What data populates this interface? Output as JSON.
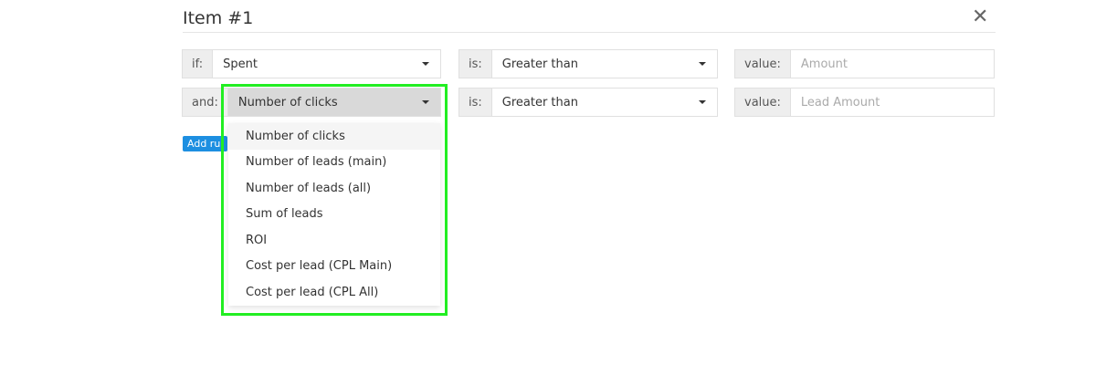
{
  "modal": {
    "title": "Item #1",
    "close_icon": "close-icon"
  },
  "rule1": {
    "prefix": "if:",
    "field": "Spent",
    "op_label": "is:",
    "operator": "Greater than",
    "value_label": "value:",
    "value_placeholder": "Amount"
  },
  "rule2": {
    "prefix": "and:",
    "field": "Number of clicks",
    "op_label": "is:",
    "operator": "Greater than",
    "value_label": "value:",
    "value_placeholder": "Lead Amount"
  },
  "add_rule_label": "Add rul",
  "dropdown_options": [
    "Number of clicks",
    "Number of leads (main)",
    "Number of leads (all)",
    "Sum of leads",
    "ROI",
    "Cost per lead (CPL Main)",
    "Cost per lead (CPL All)"
  ],
  "colors": {
    "accent": "#1d8fe1",
    "highlight": "#22ee22"
  }
}
